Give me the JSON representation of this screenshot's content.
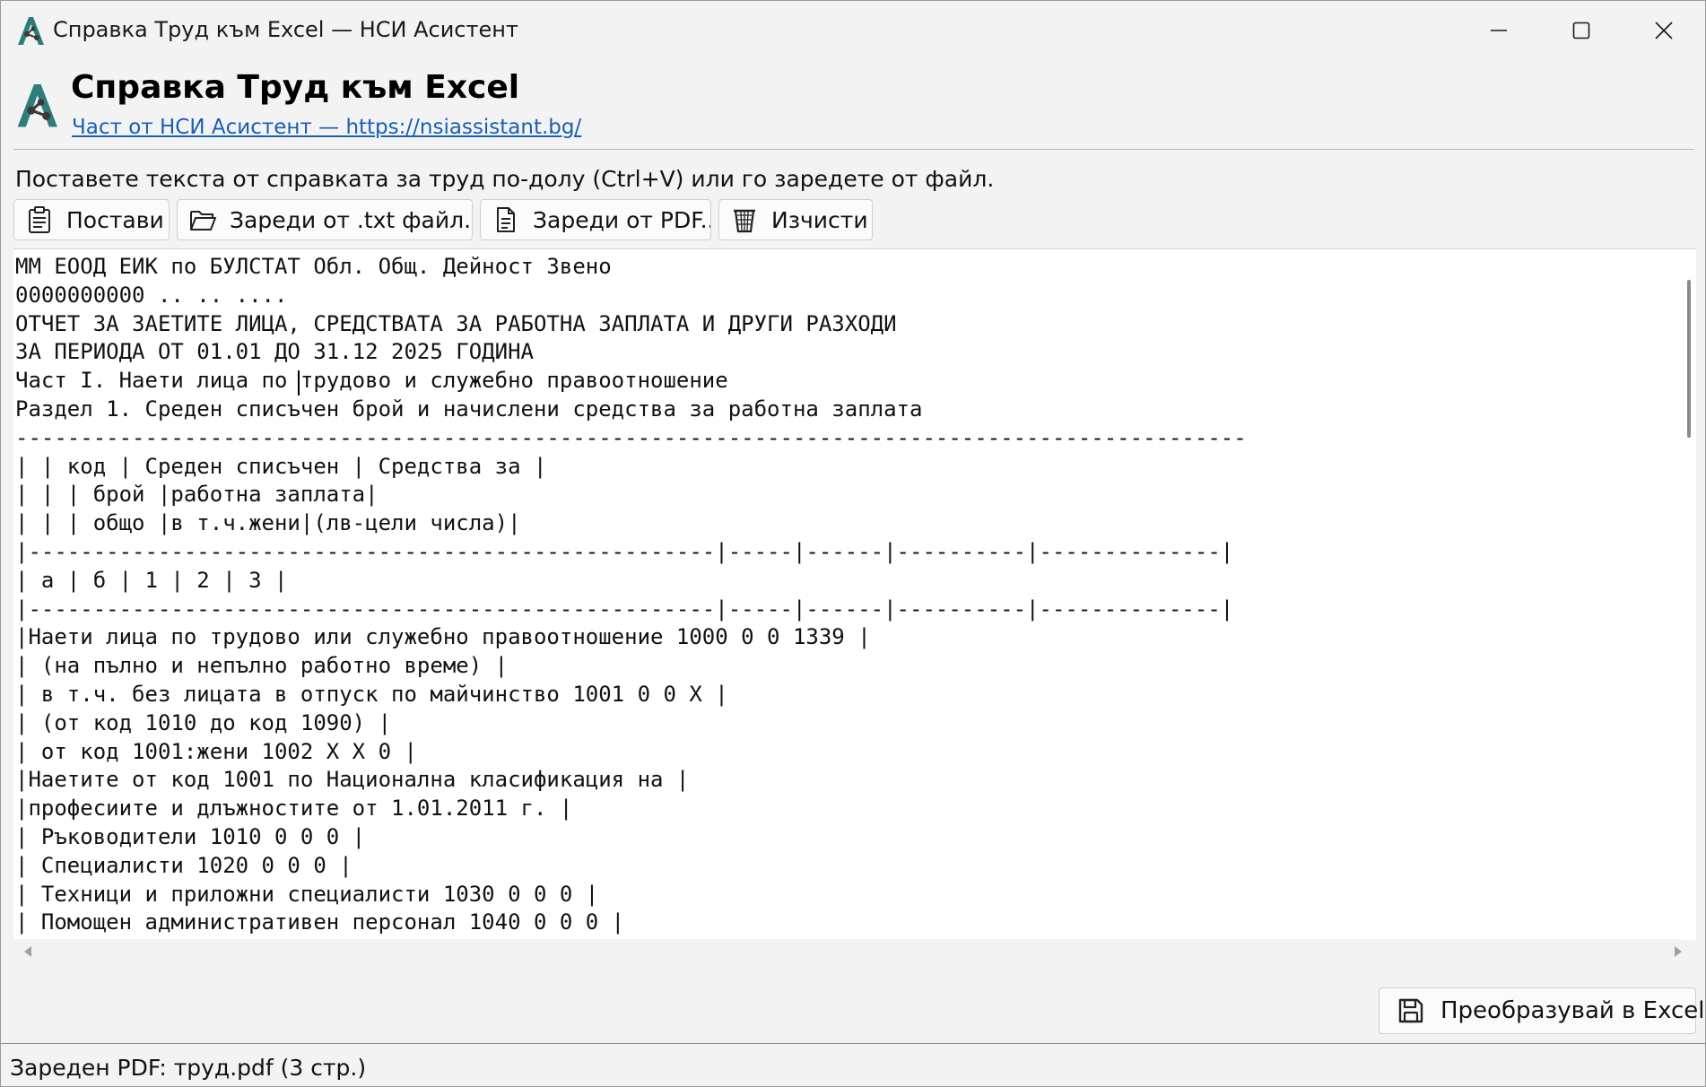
{
  "window": {
    "title": "Справка Труд към Excel — НСИ Асистент",
    "controls": {
      "minimize_icon": "minimize-icon",
      "maximize_icon": "maximize-icon",
      "close_icon": "close-icon"
    }
  },
  "header": {
    "app_name": "Справка Труд към Excel",
    "link_text": "Част от НСИ Асистент — https://nsiassistant.bg/",
    "logo_colors": {
      "primary": "#2e7d7a",
      "accent": "#3a3a3a"
    }
  },
  "instruction": "Поставете текста от справката за труд по-долу (Ctrl+V) или го заредете от файл.",
  "toolbar": {
    "paste_label": "Постави",
    "load_txt_label": "Зареди от .txt файл...",
    "load_pdf_label": "Зареди от PDF...",
    "clear_label": "Изчисти"
  },
  "editor": {
    "lines": [
      "ММ ЕООД ЕИК по БУЛСТАТ Обл. Общ. Дейност Звено",
      "0000000000 .. .. ....",
      "ОТЧЕТ ЗА ЗАЕТИТЕ ЛИЦА, СРЕДСТВАТА ЗА РАБОТНА ЗАПЛАТА И ДРУГИ РАЗХОДИ",
      "ЗА ПЕРИОДА ОТ 01.01 ДО 31.12 2025 ГОДИНА",
      "Част I. Наети лица по трудово и служебно правоотношение",
      "Раздел 1. Среден списъчен брой и начислени средства за работна заплата",
      "-----------------------------------------------------------------------------------------------",
      "| | код | Среден списъчен | Средства за |",
      "| | | брой |работна заплата|",
      "| | | общо |в т.ч.жени|(лв-цели числа)|",
      "|-----------------------------------------------------|-----|------|----------|--------------|",
      "| а | б | 1 | 2 | 3 |",
      "|-----------------------------------------------------|-----|------|----------|--------------|",
      "|Наети лица по трудово или служебно правоотношение 1000 0 0 1339 |",
      "| (на пълно и непълно работно време) |",
      "| в т.ч. без лицата в отпуск по майчинство 1001 0 0 X |",
      "| (от код 1010 до код 1090) |",
      "| от код 1001:жени 1002 X X 0 |",
      "|Наетите от код 1001 по Национална класификация на |",
      "|професиите и длъжностите от 1.01.2011 г. |",
      "| Ръководители 1010 0 0 0 |",
      "| Специалисти 1020 0 0 0 |",
      "| Техници и приложни специалисти 1030 0 0 0 |",
      "| Помощен административен персонал 1040 0 0 0 |"
    ]
  },
  "convert_label": "Преобразувай в Excel",
  "status": "Зареден PDF: труд.pdf (3 стр.)"
}
